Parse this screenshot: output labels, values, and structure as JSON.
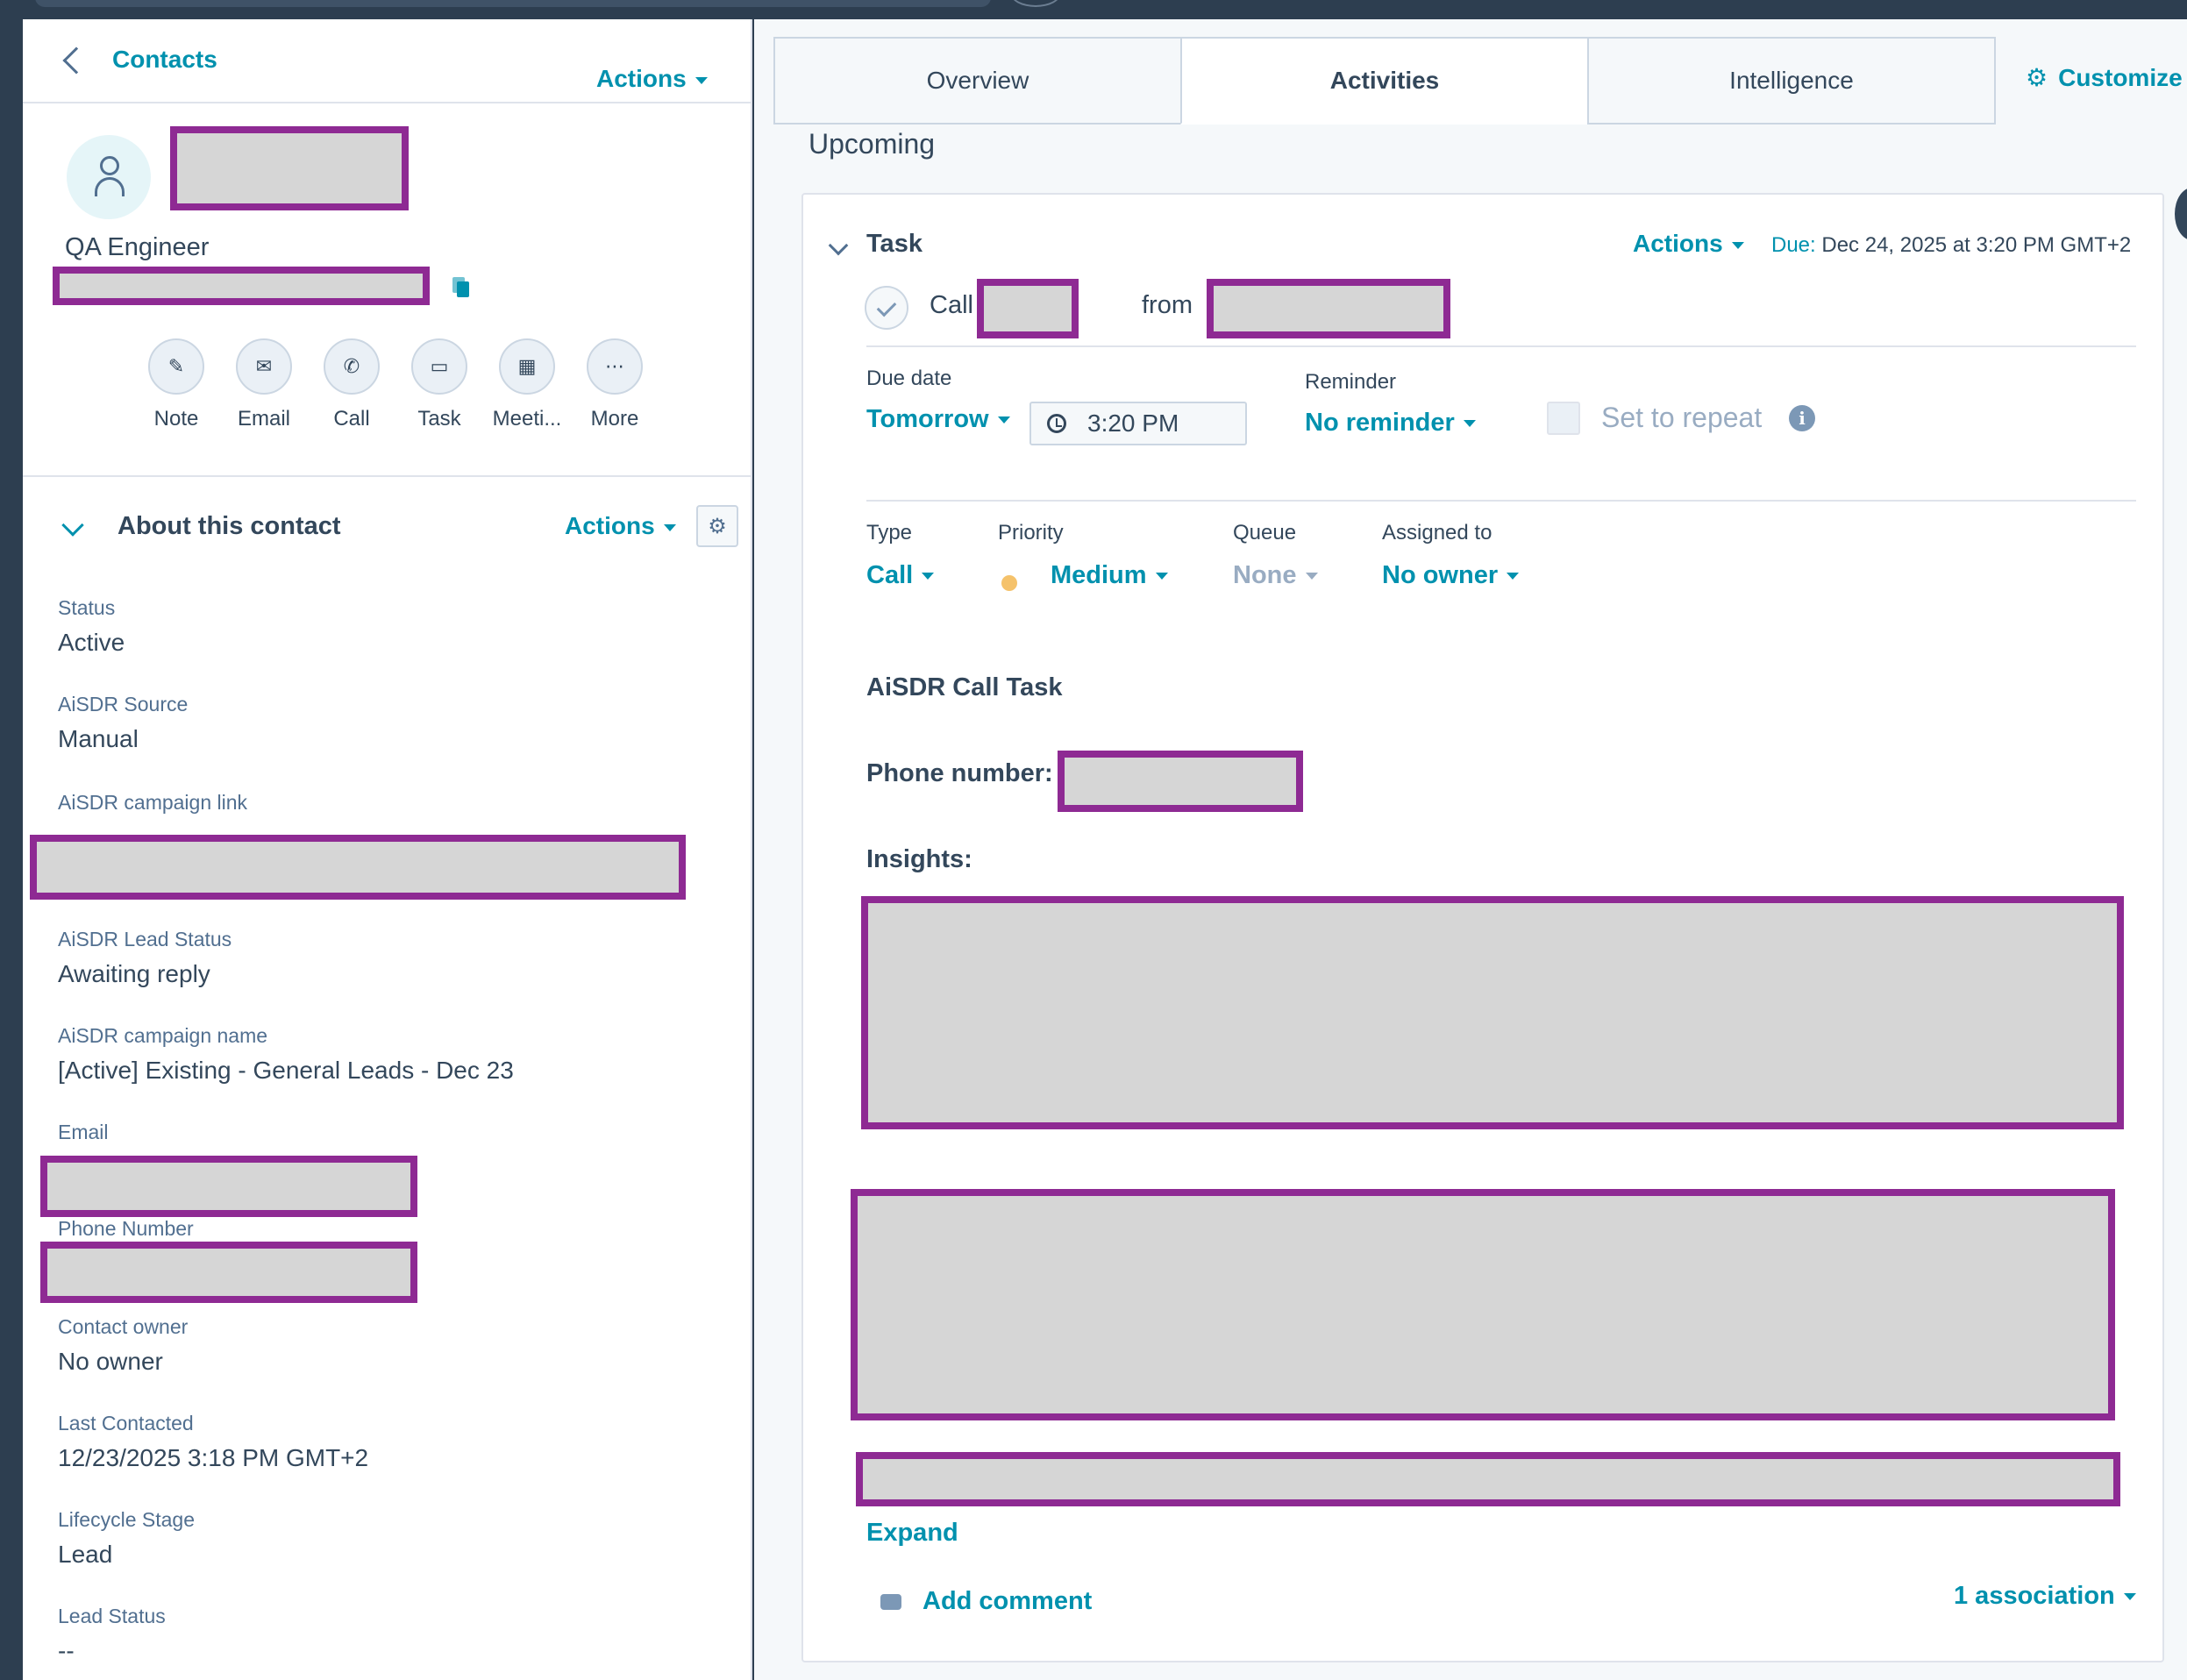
{
  "nav": {
    "back_label": "Contacts",
    "actions_label": "Actions"
  },
  "contact": {
    "job_title": "QA Engineer"
  },
  "quick_actions": [
    {
      "label": "Note",
      "icon": "note-icon",
      "glyph": "✎"
    },
    {
      "label": "Email",
      "icon": "email-icon",
      "glyph": "✉"
    },
    {
      "label": "Call",
      "icon": "phone-icon",
      "glyph": "✆"
    },
    {
      "label": "Task",
      "icon": "task-icon",
      "glyph": "▭"
    },
    {
      "label": "Meeti...",
      "icon": "calendar-icon",
      "glyph": "▦"
    },
    {
      "label": "More",
      "icon": "more-icon",
      "glyph": "⋯"
    }
  ],
  "about": {
    "title": "About this contact",
    "actions_label": "Actions",
    "gear_glyph": "⚙",
    "properties": [
      {
        "label": "Status",
        "value": "Active"
      },
      {
        "label": "AiSDR Source",
        "value": "Manual"
      },
      {
        "label": "AiSDR campaign link",
        "value": ""
      },
      {
        "label": "AiSDR Lead Status",
        "value": "Awaiting reply"
      },
      {
        "label": "AiSDR campaign name",
        "value": "[Active] Existing - General Leads - Dec 23"
      },
      {
        "label": "Email",
        "value": ""
      },
      {
        "label": "Phone Number",
        "value": ""
      },
      {
        "label": "Contact owner",
        "value": "No owner"
      },
      {
        "label": "Last Contacted",
        "value": "12/23/2025 3:18 PM GMT+2"
      },
      {
        "label": "Lifecycle Stage",
        "value": "Lead"
      },
      {
        "label": "Lead Status",
        "value": "--"
      }
    ]
  },
  "tabs": [
    {
      "label": "Overview"
    },
    {
      "label": "Activities"
    },
    {
      "label": "Intelligence"
    }
  ],
  "customize_label": "Customize",
  "customize_glyph": "⚙",
  "section_title": "Upcoming",
  "task": {
    "header": "Task",
    "actions_label": "Actions",
    "due_label": "Due:",
    "due_value": "Dec 24, 2025 at 3:20 PM GMT+2",
    "call_word": "Call",
    "from_word": "from",
    "due_date_label": "Due date",
    "due_date_value": "Tomorrow",
    "time_value": "3:20 PM",
    "reminder_label": "Reminder",
    "reminder_value": "No reminder",
    "repeat_label": "Set to repeat",
    "info_glyph": "i",
    "type_label": "Type",
    "type_value": "Call",
    "priority_label": "Priority",
    "priority_value": "Medium",
    "queue_label": "Queue",
    "queue_value": "None",
    "assigned_label": "Assigned to",
    "assigned_value": "No owner",
    "body_title": "AiSDR Call Task",
    "phone_label": "Phone number:",
    "insights_label": "Insights:",
    "expand_label": "Expand",
    "add_comment_label": "Add comment",
    "association_label": "1 association"
  },
  "colors": {
    "link": "#0091ae",
    "text": "#33475b",
    "redaction_border": "#8e2a93",
    "redaction_fill": "#d6d6d6",
    "priority_medium": "#f5c26b"
  }
}
